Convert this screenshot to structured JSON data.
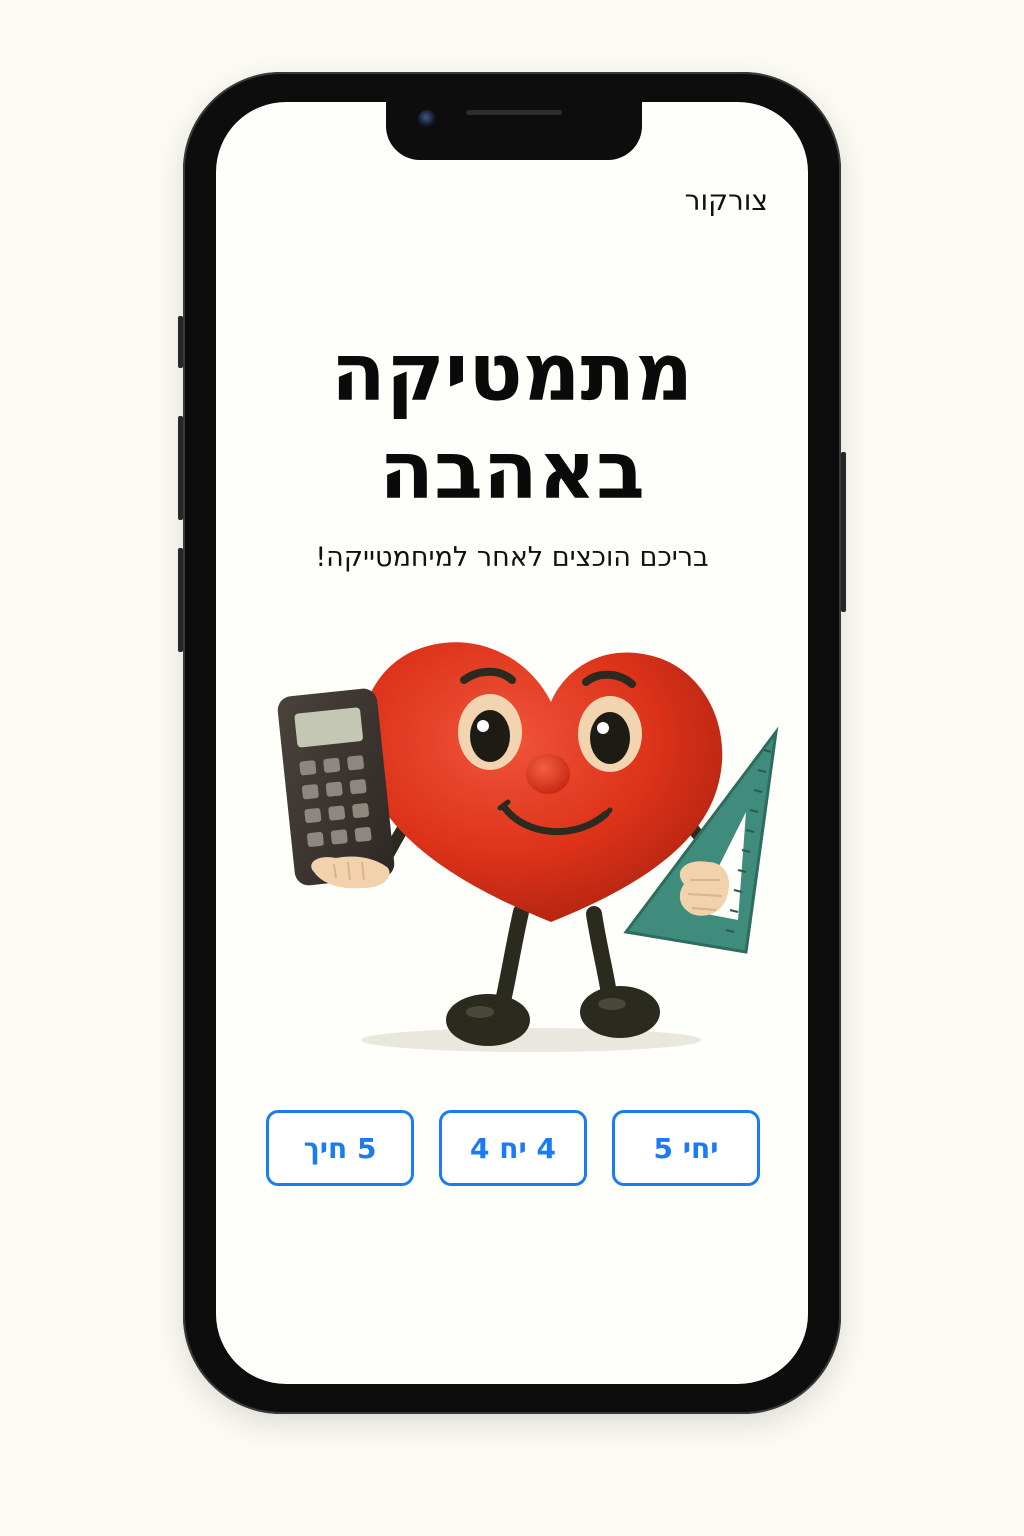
{
  "header": {
    "brand": "צורקור"
  },
  "hero": {
    "title_line1": "מתמטיקה",
    "title_line2": "באהבה",
    "subtitle": "בריכם הוכצים לאחר למיחמטייקה!"
  },
  "mascot": {
    "description_icon": "heart-mascot-icon",
    "left_hand_item": "calculator-icon",
    "right_hand_item": "set-square-icon"
  },
  "grades": [
    {
      "label": "יחי 5"
    },
    {
      "label": "4 יח 4"
    },
    {
      "label": "5 חיך"
    }
  ],
  "colors": {
    "accent": "#1a7cf0",
    "heart": "#e0351c",
    "background": "#fbfaf3"
  }
}
